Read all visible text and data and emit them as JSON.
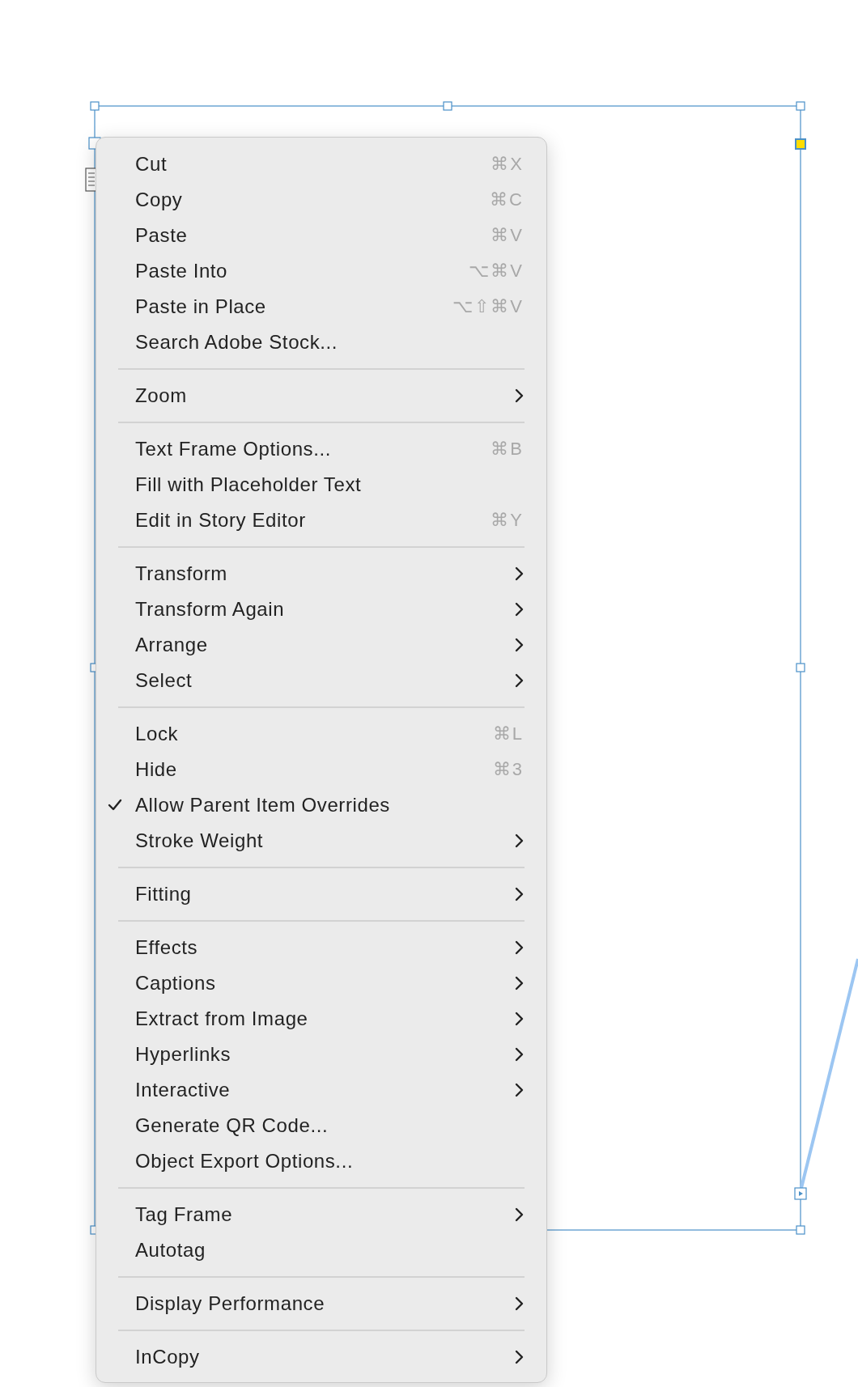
{
  "context_menu": {
    "groups": [
      {
        "items": [
          {
            "label": "Cut",
            "shortcut": "⌘X",
            "kind": "command",
            "checked": false
          },
          {
            "label": "Copy",
            "shortcut": "⌘C",
            "kind": "command",
            "checked": false
          },
          {
            "label": "Paste",
            "shortcut": "⌘V",
            "kind": "command",
            "checked": false
          },
          {
            "label": "Paste Into",
            "shortcut": "⌥⌘V",
            "kind": "command",
            "checked": false
          },
          {
            "label": "Paste in Place",
            "shortcut": "⌥⇧⌘V",
            "kind": "command",
            "checked": false
          },
          {
            "label": "Search Adobe Stock...",
            "kind": "command",
            "checked": false
          }
        ]
      },
      {
        "items": [
          {
            "label": "Zoom",
            "kind": "submenu",
            "checked": false
          }
        ]
      },
      {
        "items": [
          {
            "label": "Text Frame Options...",
            "shortcut": "⌘B",
            "kind": "command",
            "checked": false
          },
          {
            "label": "Fill with Placeholder Text",
            "kind": "command",
            "checked": false
          },
          {
            "label": "Edit in Story Editor",
            "shortcut": "⌘Y",
            "kind": "command",
            "checked": false
          }
        ]
      },
      {
        "items": [
          {
            "label": "Transform",
            "kind": "submenu",
            "checked": false
          },
          {
            "label": "Transform Again",
            "kind": "submenu",
            "checked": false
          },
          {
            "label": "Arrange",
            "kind": "submenu",
            "checked": false
          },
          {
            "label": "Select",
            "kind": "submenu",
            "checked": false
          }
        ]
      },
      {
        "items": [
          {
            "label": "Lock",
            "shortcut": "⌘L",
            "kind": "command",
            "checked": false
          },
          {
            "label": "Hide",
            "shortcut": "⌘3",
            "kind": "command",
            "checked": false
          },
          {
            "label": "Allow Parent Item Overrides",
            "kind": "command",
            "checked": true
          },
          {
            "label": "Stroke Weight",
            "kind": "submenu",
            "checked": false
          }
        ]
      },
      {
        "items": [
          {
            "label": "Fitting",
            "kind": "submenu",
            "checked": false
          }
        ]
      },
      {
        "items": [
          {
            "label": "Effects",
            "kind": "submenu",
            "checked": false
          },
          {
            "label": "Captions",
            "kind": "submenu",
            "checked": false
          },
          {
            "label": "Extract from Image",
            "kind": "submenu",
            "checked": false
          },
          {
            "label": "Hyperlinks",
            "kind": "submenu",
            "checked": false
          },
          {
            "label": "Interactive",
            "kind": "submenu",
            "checked": false
          },
          {
            "label": "Generate QR Code...",
            "kind": "command",
            "checked": false
          },
          {
            "label": "Object Export Options...",
            "kind": "command",
            "checked": false
          }
        ]
      },
      {
        "items": [
          {
            "label": "Tag Frame",
            "kind": "submenu",
            "checked": false
          },
          {
            "label": "Autotag",
            "kind": "command",
            "checked": false
          }
        ]
      },
      {
        "items": [
          {
            "label": "Display Performance",
            "kind": "submenu",
            "checked": false
          }
        ]
      },
      {
        "items": [
          {
            "label": "InCopy",
            "kind": "submenu",
            "checked": false
          }
        ]
      }
    ]
  }
}
